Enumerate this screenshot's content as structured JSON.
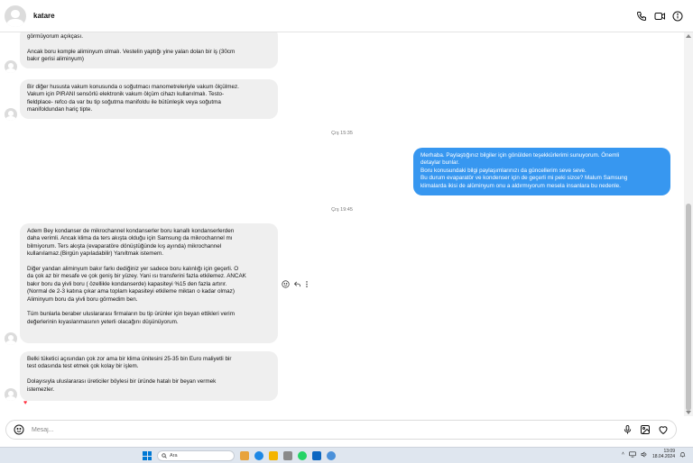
{
  "header": {
    "contact_name": "katare",
    "icons": [
      "phone-icon",
      "video-call-icon",
      "info-icon"
    ]
  },
  "messages": [
    {
      "id": "m1",
      "direction": "incoming",
      "text": "görmüyorum açıkçası.\n\nAncak boru komple aliminyum olmalı. Vestelin yaptığı yine yalan dolan bir iş (30cm\nbakır gerisi aliminyum)"
    },
    {
      "id": "m2",
      "direction": "incoming",
      "text": "Bir diğer husus​ta vakum konusunda o soğutmacı manometreleriyle vakum ölçülmez.\nVakum için PIRANI sensörlü elektronik vakum ölçüm cihazı kullanılmalı. Testo-\nfieldplace- refco da var bu tip soğutma manifoldu ile bütünleşik veya soğutma\nmanifoldundan hariç tipte."
    },
    {
      "id": "t1",
      "direction": "time",
      "text": "Çrş 15:35"
    },
    {
      "id": "m3",
      "direction": "outgoing",
      "text": "Merhaba. Paylaştığınız bilgiler için gönülden teşekkürlerimi sunuyorum. Önemli\ndetaylar bunlar.\nBoru konusundaki bilgi paylaşımlarınızı da güncellerim seve seve.\nBu durum evaparatör ve kondenser için de geçerli mi peki sizce? Malum Samsung\nklimalarda ikisi de alüminyum onu a aldırmıyorum mesela insanlara bu nedenle."
    },
    {
      "id": "t2",
      "direction": "time",
      "text": "Çrş 19:45"
    },
    {
      "id": "m4",
      "direction": "incoming",
      "text": "Adem Bey kondanser de mikrochannel kondanserler boru kanallı kondanserlerden\ndaha verimli. Ancak klima da ters akışta olduğu için Samsung da mikrochannel mı\nbilmiyorum. Ters akışta (evaparatöre dönüştüğünde kış ayında) mikrochannel\nkullanılamaz.(Birgün yapıladabilir) Yanıltmak istemem.\n\nDiğer yandan aliminyum bakır farkı dediğiniz yer sadece boru kalınlığı için geçerli. O\nda çok az bir mesafe ve çok geniş bir yüzey. Yani ısı transferini fazla etkilemez. ANCAK\nbakır boru da yivli boru ( özellikle kondanserde) kapasiteyi %15 den fazla artırır.\n(Normal de 2-3 katına çıkar ama toplam kapasiteyi etkileme miktarı o kadar olmaz)\nAliminyum boru da yivli boru görmedim ben.\n\nTüm bunlarla beraber uluslararası firmaların bu tip ürünler için beyan ettikleri verim\ndeğerlerinin kıyaslanmasının yeterli olacağını düşünüyorum."
    },
    {
      "id": "m5",
      "direction": "incoming",
      "text": "Belki tüketici açısından çok zor ama bir klima ünitesini 25-35 bin Euro maliyetli bir\ntest odasında test etmek çok kolay bir işlem.\n\nDolayısıyla uluslararası üreticiler böylesi bir üründe hatalı bir beyan vermek\nistemezler."
    }
  ],
  "reaction": "♥",
  "composer": {
    "placeholder": "Mesaj..."
  },
  "taskbar": {
    "search_placeholder": "Ara",
    "clock_time": "13:09",
    "clock_date": "18.04.2024",
    "app_colors": [
      "#e8a33d",
      "#1e88e5",
      "#f4b400",
      "#8a8a8a",
      "#25d366",
      "#0a66c2",
      "#4a90d9"
    ]
  },
  "colors": {
    "outgoing_bubble": "#3797f0",
    "incoming_bubble": "#efefef",
    "heart": "#ff3040"
  }
}
